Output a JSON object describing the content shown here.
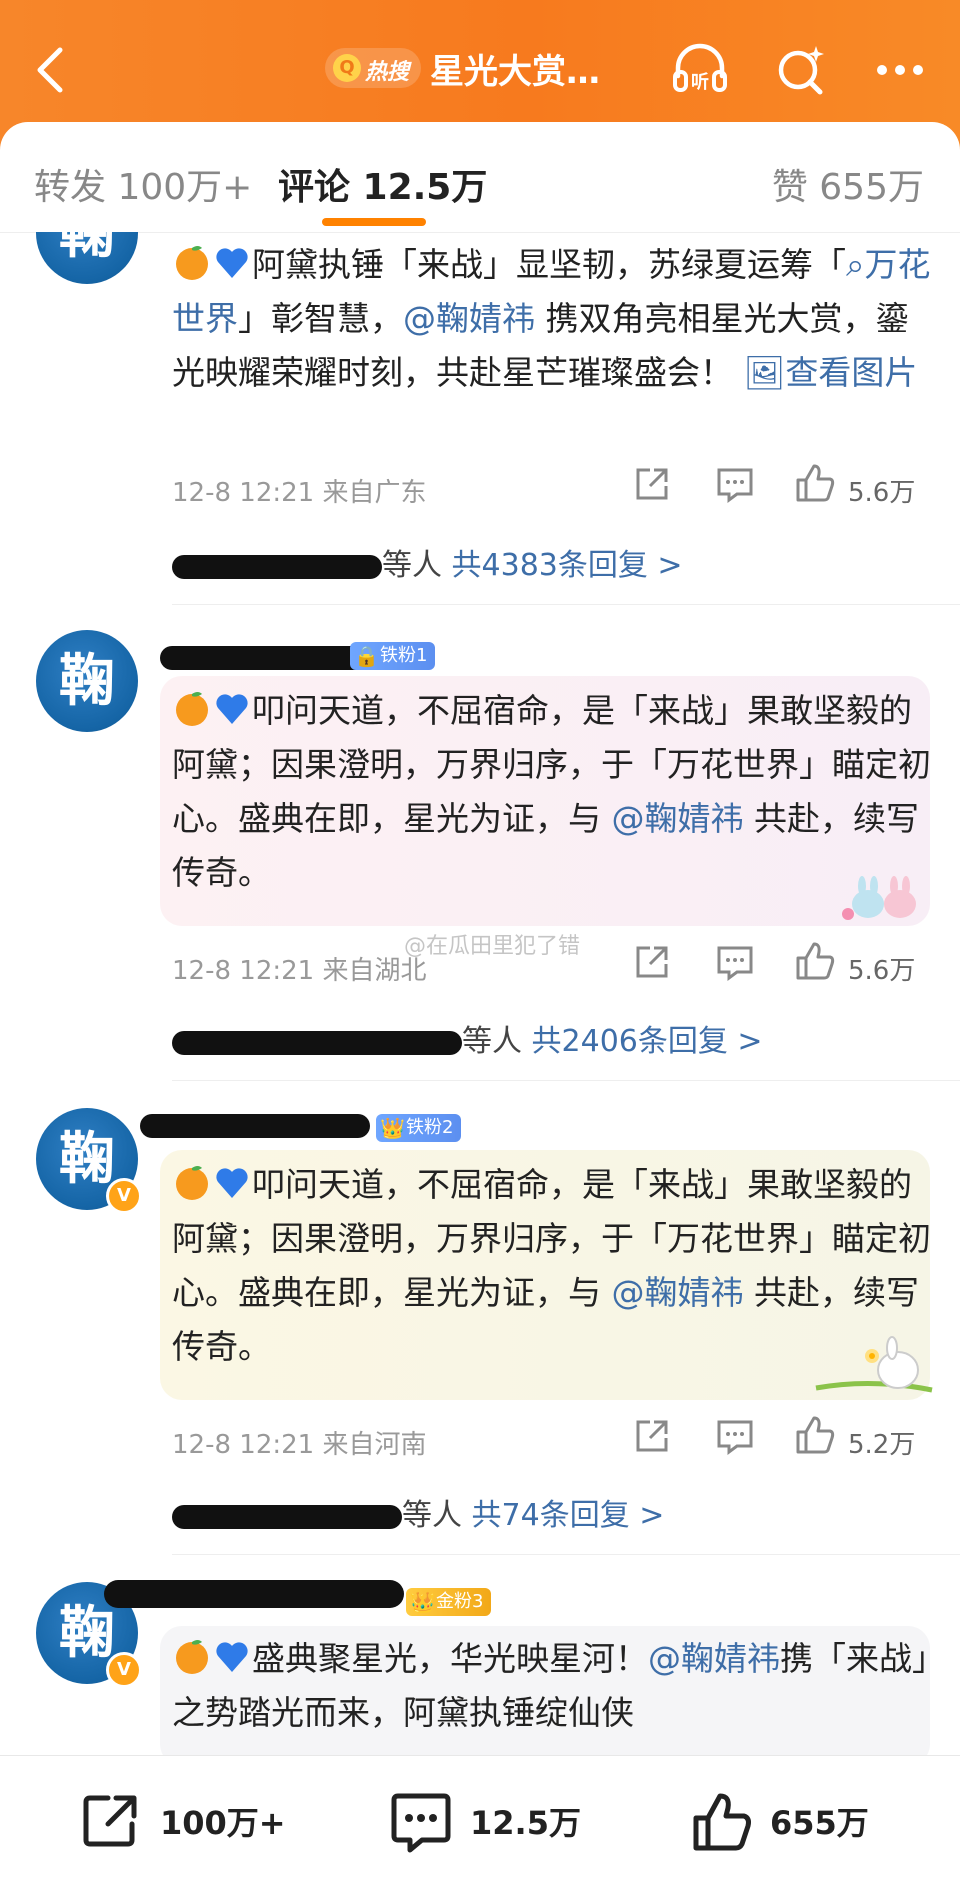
{
  "header": {
    "hot_search_label": "热搜",
    "topic_title": "星光大赏…"
  },
  "tabs": {
    "repost": "转发 100万+",
    "comment": "评论 12.5万",
    "like": "赞 655万"
  },
  "comments": [
    {
      "avatar_char": "鞠",
      "content": {
        "emojis": [
          "orange-emoji",
          "blue-heart-emoji"
        ],
        "t1": "阿黛执锤「来战」显坚韧，苏绿夏运筹「",
        "topic_link": "万花世界",
        "t2": "」彰智慧，",
        "mention": "@鞠婧祎",
        "t3": " 携双角亮相星光大赏，鎏光映耀荣耀时刻，共赴星芒璀璨盛会！",
        "image_link": "查看图片"
      },
      "time": "12-8 12:21",
      "location": "来自广东",
      "likes": "5.6万",
      "reply_suffix": "等人",
      "reply_total": "共4383条回复 >"
    },
    {
      "avatar_char": "鞠",
      "fan_badge": "铁粉1",
      "content": {
        "emojis": [
          "orange-emoji",
          "blue-heart-emoji"
        ],
        "t1": "叩问天道，不屈宿命，是「来战」果敢坚毅的阿黛；因果澄明，万界归序，于「万花世界」瞄定初心。盛典在即，星光为证，与 ",
        "mention": "@鞠婧祎",
        "t2": " 共赴，续写传奇。"
      },
      "time": "12-8 12:21",
      "location": "来自湖北",
      "likes": "5.6万",
      "reply_suffix": "等人",
      "reply_total": "共2406条回复 >"
    },
    {
      "avatar_char": "鞠",
      "verified": "V",
      "fan_badge": "铁粉2",
      "content": {
        "emojis": [
          "orange-emoji",
          "blue-heart-emoji"
        ],
        "t1": "叩问天道，不屈宿命，是「来战」果敢坚毅的阿黛；因果澄明，万界归序，于「万花世界」瞄定初心。盛典在即，星光为证，与 ",
        "mention": "@鞠婧祎",
        "t2": " 共赴，续写传奇。"
      },
      "time": "12-8 12:21",
      "location": "来自河南",
      "likes": "5.2万",
      "reply_suffix": "等人",
      "reply_total": "共74条回复 >"
    },
    {
      "avatar_char": "鞠",
      "verified": "V",
      "fan_badge": "金粉3",
      "content": {
        "emojis": [
          "orange-emoji",
          "blue-heart-emoji"
        ],
        "t1": "盛典聚星光，华光映星河！",
        "mention": "@鞠婧祎",
        "t2": "携「来战」之势踏光而来，阿黛执锤绽仙侠"
      }
    }
  ],
  "watermark": "@在瓜田里犯了错",
  "bottom_bar": {
    "repost": "100万+",
    "comment": "12.5万",
    "like": "655万"
  },
  "colors": {
    "header_orange": "#f7862a",
    "link_blue": "#3e6ea8",
    "tab_indicator": "#ff8200"
  }
}
